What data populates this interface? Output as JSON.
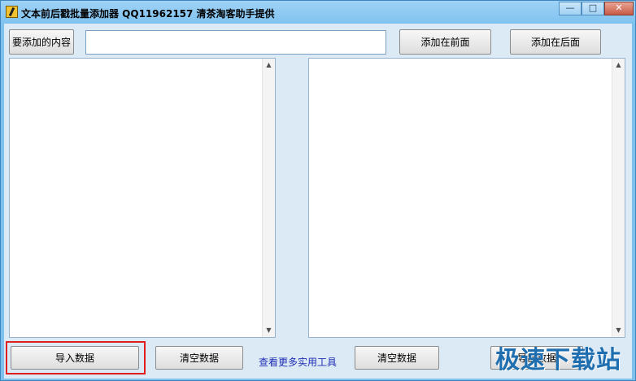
{
  "window": {
    "title": "文本前后戳批量添加器 QQ11962157 清茶淘客助手提供",
    "minimize": "—",
    "maximize": "□",
    "close": "✕"
  },
  "toolbar": {
    "label_button": "要添加的内容",
    "content_input_value": "",
    "add_front": "添加在前面",
    "add_back": "添加在后面"
  },
  "bottom": {
    "import": "导入数据",
    "clear_left": "清空数据",
    "more_tools": "查看更多实用工具",
    "clear_right": "清空数据",
    "export": "导出数据"
  },
  "watermark": "极速下载站"
}
